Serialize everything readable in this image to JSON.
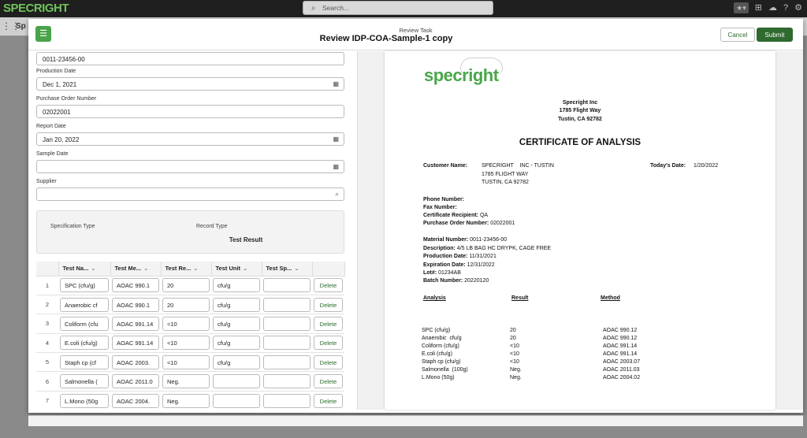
{
  "app": {
    "logo": "SPECRIGHT",
    "search_placeholder": "Search...",
    "app_tab": "Sp"
  },
  "modal": {
    "subtitle": "Review Task",
    "title": "Review IDP-COA-Sample-1 copy",
    "cancel_label": "Cancel",
    "submit_label": "Submit"
  },
  "form": {
    "material_number_value": "0011-23456-00",
    "production_date_label": "Production Date",
    "production_date_value": "Dec 1, 2021",
    "po_label": "Purchase Order Number",
    "po_value": "02022001",
    "report_date_label": "Report Date",
    "report_date_value": "Jan 20, 2022",
    "sample_date_label": "Sample Date",
    "sample_date_value": "",
    "supplier_label": "Supplier",
    "supplier_value": "",
    "spec_type_label": "Specification Type",
    "record_type_label": "Record Type",
    "record_type_value": "Test Result"
  },
  "table": {
    "headers": [
      "Test Na...",
      "Test Me...",
      "Test Re...",
      "Test Unit",
      "Test Sp..."
    ],
    "rows": [
      {
        "num": "1",
        "name": "SPC (cfu/g)",
        "method": "AOAC 990.1",
        "result": "20",
        "unit": "cfu/g",
        "spec": "",
        "action": "Delete"
      },
      {
        "num": "2",
        "name": "Anaerobic cf",
        "method": "AOAC 990.1",
        "result": "20",
        "unit": "cfu/g",
        "spec": "",
        "action": "Delete"
      },
      {
        "num": "3",
        "name": "Coliform (cfu",
        "method": "AOAC 991.14",
        "result": "<10",
        "unit": "cfu/g",
        "spec": "",
        "action": "Delete"
      },
      {
        "num": "4",
        "name": "E.coli (cfu/g)",
        "method": "AOAC 991.14",
        "result": "<10",
        "unit": "cfu/g",
        "spec": "",
        "action": "Delete"
      },
      {
        "num": "5",
        "name": "Staph cp (cf",
        "method": "AOAC 2003.",
        "result": "<10",
        "unit": "cfu/g",
        "spec": "",
        "action": "Delete"
      },
      {
        "num": "6",
        "name": "Salmonella (",
        "method": "AOAC 2011.0",
        "result": "Neg.",
        "unit": "",
        "spec": "",
        "action": "Delete"
      },
      {
        "num": "7",
        "name": "L.Mono (50g",
        "method": "AOAC 2004.",
        "result": "Neg.",
        "unit": "",
        "spec": "",
        "action": "Delete"
      }
    ]
  },
  "document": {
    "logo": "specright",
    "company": "Specright Inc",
    "address1": "1785 Flight Way",
    "address2": "Tustin, CA 92782",
    "heading": "CERTIFICATE OF ANALYSIS",
    "customer_name_label": "Customer Name:",
    "customer_name": "SPECRIGHT    INC - TUSTIN",
    "customer_addr1": "1785 FLIGHT WAY",
    "customer_addr2": "TUSTIN, CA 92782",
    "todays_date_label": "Today's Date:",
    "todays_date": "1/20/2022",
    "phone_label": "Phone Number:",
    "fax_label": "Fax Number:",
    "recipient_label": "Certificate Recipient:",
    "recipient": "QA",
    "po_label": "Purchase Order Number:",
    "po": "02022001",
    "material_label": "Material Number:",
    "material": "0011-23456-00",
    "description_label": "Description:",
    "description": "4/5 LB BAG HC DRYPK, CAGE FREE",
    "production_label": "Production Date:",
    "production": "11/31/2021",
    "expiration_label": "Expiration Date:",
    "expiration": "12/31/2022",
    "lot_label": "Lot#:",
    "lot": "01234AB",
    "batch_label": "Batch Number:",
    "batch": "20220120",
    "col_analysis": "Analysis",
    "col_result": "Result",
    "col_method": "Method",
    "results": [
      {
        "analysis": "SPC (cfu/g)",
        "result": "20",
        "method": "AOAC 990.12"
      },
      {
        "analysis": "Anaerobic  cfu/g",
        "result": "20",
        "method": "AOAC 990.12"
      },
      {
        "analysis": "Coliform (cfu/g)",
        "result": "<10",
        "method": "AOAC 991.14"
      },
      {
        "analysis": "E.coli (cfu/g)",
        "result": "<10",
        "method": "AOAC 991.14"
      },
      {
        "analysis": "Staph cp (cfu/g)",
        "result": "<10",
        "method": "AOAC 2003.07"
      },
      {
        "analysis": "Salmonella  (100g)",
        "result": "Neg.",
        "method": "AOAC 2011.03"
      },
      {
        "analysis": "L.Mono (50g)",
        "result": "Neg.",
        "method": "AOAC 2004.02"
      }
    ]
  }
}
